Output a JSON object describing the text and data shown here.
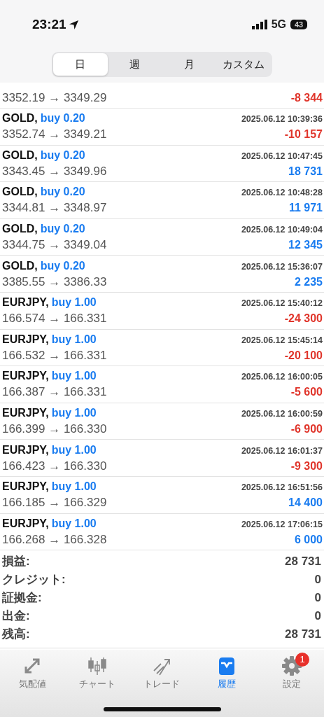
{
  "status_bar": {
    "time": "23:21",
    "network": "5G",
    "battery": "43"
  },
  "period_tabs": [
    {
      "label": "日",
      "selected": true
    },
    {
      "label": "週",
      "selected": false
    },
    {
      "label": "月",
      "selected": false
    },
    {
      "label": "カスタム",
      "selected": false
    }
  ],
  "deals": [
    {
      "prices": "3352.19 → 3349.29",
      "profit": "-8 344",
      "loss": true
    },
    {
      "symbol": "GOLD,",
      "side": "buy 0.20",
      "time": "2025.06.12 10:39:36",
      "prices": "3352.74 → 3349.21",
      "profit": "-10 157",
      "loss": true
    },
    {
      "symbol": "GOLD,",
      "side": "buy 0.20",
      "time": "2025.06.12 10:47:45",
      "prices": "3343.45 → 3349.96",
      "profit": "18 731",
      "loss": false
    },
    {
      "symbol": "GOLD,",
      "side": "buy 0.20",
      "time": "2025.06.12 10:48:28",
      "prices": "3344.81 → 3348.97",
      "profit": "11 971",
      "loss": false
    },
    {
      "symbol": "GOLD,",
      "side": "buy 0.20",
      "time": "2025.06.12 10:49:04",
      "prices": "3344.75 → 3349.04",
      "profit": "12 345",
      "loss": false
    },
    {
      "symbol": "GOLD,",
      "side": "buy 0.20",
      "time": "2025.06.12 15:36:07",
      "prices": "3385.55 → 3386.33",
      "profit": "2 235",
      "loss": false
    },
    {
      "symbol": "EURJPY,",
      "side": "buy 1.00",
      "time": "2025.06.12 15:40:12",
      "prices": "166.574 → 166.331",
      "profit": "-24 300",
      "loss": true
    },
    {
      "symbol": "EURJPY,",
      "side": "buy 1.00",
      "time": "2025.06.12 15:45:14",
      "prices": "166.532 → 166.331",
      "profit": "-20 100",
      "loss": true
    },
    {
      "symbol": "EURJPY,",
      "side": "buy 1.00",
      "time": "2025.06.12 16:00:05",
      "prices": "166.387 → 166.331",
      "profit": "-5 600",
      "loss": true
    },
    {
      "symbol": "EURJPY,",
      "side": "buy 1.00",
      "time": "2025.06.12 16:00:59",
      "prices": "166.399 → 166.330",
      "profit": "-6 900",
      "loss": true
    },
    {
      "symbol": "EURJPY,",
      "side": "buy 1.00",
      "time": "2025.06.12 16:01:37",
      "prices": "166.423 → 166.330",
      "profit": "-9 300",
      "loss": true
    },
    {
      "symbol": "EURJPY,",
      "side": "buy 1.00",
      "time": "2025.06.12 16:51:56",
      "prices": "166.185 → 166.329",
      "profit": "14 400",
      "loss": false
    },
    {
      "symbol": "EURJPY,",
      "side": "buy 1.00",
      "time": "2025.06.12 17:06:15",
      "prices": "166.268 → 166.328",
      "profit": "6 000",
      "loss": false
    }
  ],
  "summary": [
    {
      "label": "損益:",
      "value": "28 731"
    },
    {
      "label": "クレジット:",
      "value": "0"
    },
    {
      "label": "証拠金:",
      "value": "0"
    },
    {
      "label": "出金:",
      "value": "0"
    },
    {
      "label": "残高:",
      "value": "28 731"
    }
  ],
  "bottom_tabs": [
    {
      "kind": "quotes",
      "label": "気配値",
      "selected": false
    },
    {
      "kind": "chart",
      "label": "チャート",
      "selected": false
    },
    {
      "kind": "trade",
      "label": "トレード",
      "selected": false
    },
    {
      "kind": "history",
      "label": "履歴",
      "selected": true
    },
    {
      "kind": "settings",
      "label": "設定",
      "selected": false,
      "badge": "1"
    }
  ]
}
